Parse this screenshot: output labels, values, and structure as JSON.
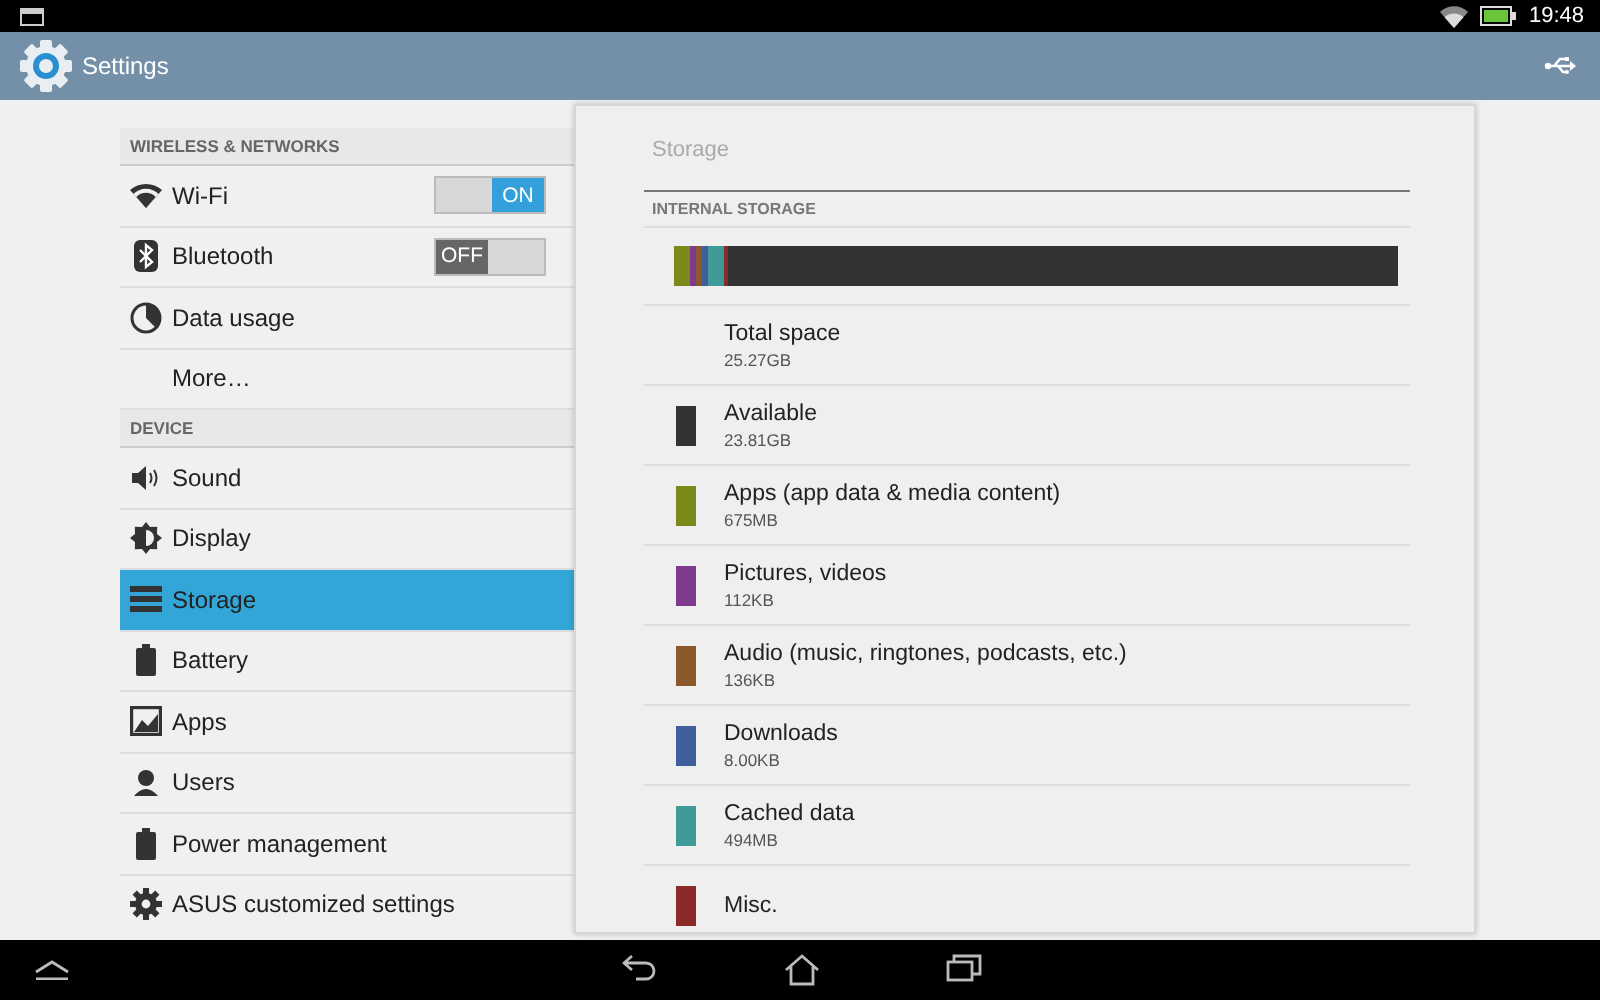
{
  "status_bar": {
    "time": "19:48"
  },
  "action_bar": {
    "title": "Settings"
  },
  "sidebar": {
    "sections": [
      {
        "header": "WIRELESS & NETWORKS",
        "items": [
          {
            "label": "Wi-Fi",
            "selected": false,
            "toggle": {
              "on": true,
              "label": "ON"
            }
          },
          {
            "label": "Bluetooth",
            "selected": false,
            "toggle": {
              "on": false,
              "label": "OFF"
            }
          },
          {
            "label": "Data usage",
            "selected": false
          },
          {
            "label": "More…",
            "selected": false
          }
        ]
      },
      {
        "header": "DEVICE",
        "items": [
          {
            "label": "Sound",
            "selected": false
          },
          {
            "label": "Display",
            "selected": false
          },
          {
            "label": "Storage",
            "selected": true
          },
          {
            "label": "Battery",
            "selected": false
          },
          {
            "label": "Apps",
            "selected": false
          },
          {
            "label": "Users",
            "selected": false
          },
          {
            "label": "Power management",
            "selected": false
          },
          {
            "label": "ASUS customized settings",
            "selected": false
          }
        ]
      }
    ]
  },
  "panel": {
    "title": "Storage",
    "section": "INTERNAL STORAGE",
    "items": [
      {
        "name": "Total space",
        "size": "25.27GB"
      },
      {
        "name": "Available",
        "size": "23.81GB",
        "color": "#333333",
        "level": 0.915
      },
      {
        "name": "Apps (app data & media content)",
        "size": "675MB",
        "color": "#7c8a1c",
        "level": 0.022
      },
      {
        "name": "Pictures, videos",
        "size": "112KB",
        "color": "#7e3a8c",
        "level": 0.008
      },
      {
        "name": "Audio (music, ringtones, podcasts, etc.)",
        "size": "136KB",
        "color": "#8c5a2a",
        "level": 0.008
      },
      {
        "name": "Downloads",
        "size": "8.00KB",
        "color": "#3e5e9c",
        "level": 0.008
      },
      {
        "name": "Cached data",
        "size": "494MB",
        "color": "#3f9a98",
        "level": 0.022
      },
      {
        "name": "Misc.",
        "color": "#8c2a2a",
        "level": 0.008
      }
    ]
  }
}
